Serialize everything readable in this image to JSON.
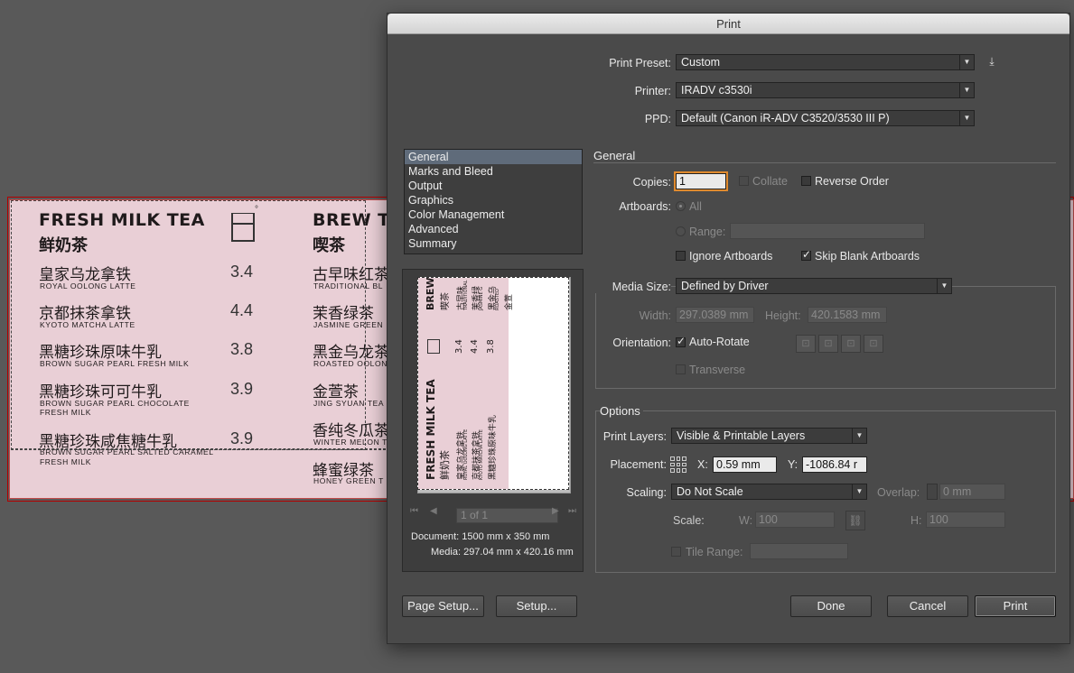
{
  "menu": {
    "col1_title": "FRESH MILK TEA",
    "col1_title_cn": "鲜奶茶",
    "col1_items": [
      {
        "cn": "皇家乌龙拿铁",
        "en": "ROYAL OOLONG LATTE",
        "price": "3.4"
      },
      {
        "cn": "京都抹茶拿铁",
        "en": "KYOTO MATCHA LATTE",
        "price": "4.4"
      },
      {
        "cn": "黑糖珍珠原味牛乳",
        "en": "BROWN SUGAR PEARL FRESH MILK",
        "price": "3.8"
      },
      {
        "cn": "黑糖珍珠可可牛乳",
        "en": "BROWN SUGAR PEARL CHOCOLATE",
        "en2": "FRESH MILK",
        "price": "3.9"
      },
      {
        "cn": "黑糖珍珠咸焦糖牛乳",
        "en": "BROWN SUGAR PEARL SALTED CARAMEL",
        "en2": "FRESH MILK",
        "price": "3.9"
      }
    ],
    "col2_title": "BREW T",
    "col2_title_cn": "喫茶",
    "col2_items": [
      {
        "cn": "古早味红茶",
        "en": "TRADITIONAL BL"
      },
      {
        "cn": "茉香绿茶",
        "en": "JASMINE GREEN"
      },
      {
        "cn": "黑金乌龙茶",
        "en": "ROASTED OOLON"
      },
      {
        "cn": "金萱茶",
        "en": "JING SYUAN TEA"
      },
      {
        "cn": "香纯冬瓜茶",
        "en": "WINTER MELON T"
      },
      {
        "cn": "蜂蜜绿茶",
        "en": "HONEY GREEN T"
      }
    ]
  },
  "dialog": {
    "title": "Print",
    "print_preset_label": "Print Preset:",
    "print_preset_value": "Custom",
    "printer_label": "Printer:",
    "printer_value": "IRADV c3530i",
    "ppd_label": "PPD:",
    "ppd_value": "Default (Canon iR-ADV C3520/3530 III P)",
    "categories": [
      "General",
      "Marks and Bleed",
      "Output",
      "Graphics",
      "Color Management",
      "Advanced",
      "Summary"
    ],
    "selected_category": "General",
    "general_title": "General",
    "copies_label": "Copies:",
    "copies_value": "1",
    "collate_label": "Collate",
    "reverse_order_label": "Reverse Order",
    "artboards_label": "Artboards:",
    "all_label": "All",
    "range_label": "Range:",
    "ignore_artboards_label": "Ignore Artboards",
    "skip_blank_label": "Skip Blank Artboards",
    "media_size_label": "Media Size:",
    "media_size_value": "Defined by Driver",
    "width_label": "Width:",
    "width_value": "297.0389 mm",
    "height_label": "Height:",
    "height_value": "420.1583 mm",
    "orientation_label": "Orientation:",
    "auto_rotate_label": "Auto-Rotate",
    "transverse_label": "Transverse",
    "options_title": "Options",
    "print_layers_label": "Print Layers:",
    "print_layers_value": "Visible & Printable Layers",
    "placement_label": "Placement:",
    "x_label": "X:",
    "x_value": "0.59 mm",
    "y_label": "Y:",
    "y_value": "-1086.84 r",
    "scaling_label": "Scaling:",
    "scaling_value": "Do Not Scale",
    "overlap_label": "Overlap:",
    "overlap_value": "0 mm",
    "scale_label": "Scale:",
    "w_label": "W:",
    "w_value": "100",
    "h_label": "H:",
    "h_value": "100",
    "tile_range_label": "Tile Range:",
    "pager_value": "1 of 1",
    "document_info": "Document: 1500 mm x 350 mm",
    "media_info": "Media: 297.04 mm x 420.16 mm",
    "page_setup_label": "Page Setup...",
    "setup_label": "Setup...",
    "done_label": "Done",
    "cancel_label": "Cancel",
    "print_label": "Print"
  },
  "preview": {
    "title": "FRESH MILK TEA",
    "title_cn": "鲜奶茶",
    "col2": "BREW",
    "col2_cn": "喫茶",
    "prices": [
      "3.4",
      "4.4",
      "3.8"
    ],
    "items_cn": [
      "皇家乌龙拿铁",
      "京都抹茶拿铁",
      "黑糖珍珠原味牛乳"
    ],
    "items_en": [
      "ROYAL OOLONG LATTE",
      "KYOTO MATCHA LATTE"
    ],
    "col2_items_cn": [
      "古早味",
      "茉香绿",
      "黑金乌",
      "金萱"
    ],
    "col2_items_en": [
      "TRADITIONAL",
      "JASMINE G",
      "ROASTED"
    ]
  }
}
